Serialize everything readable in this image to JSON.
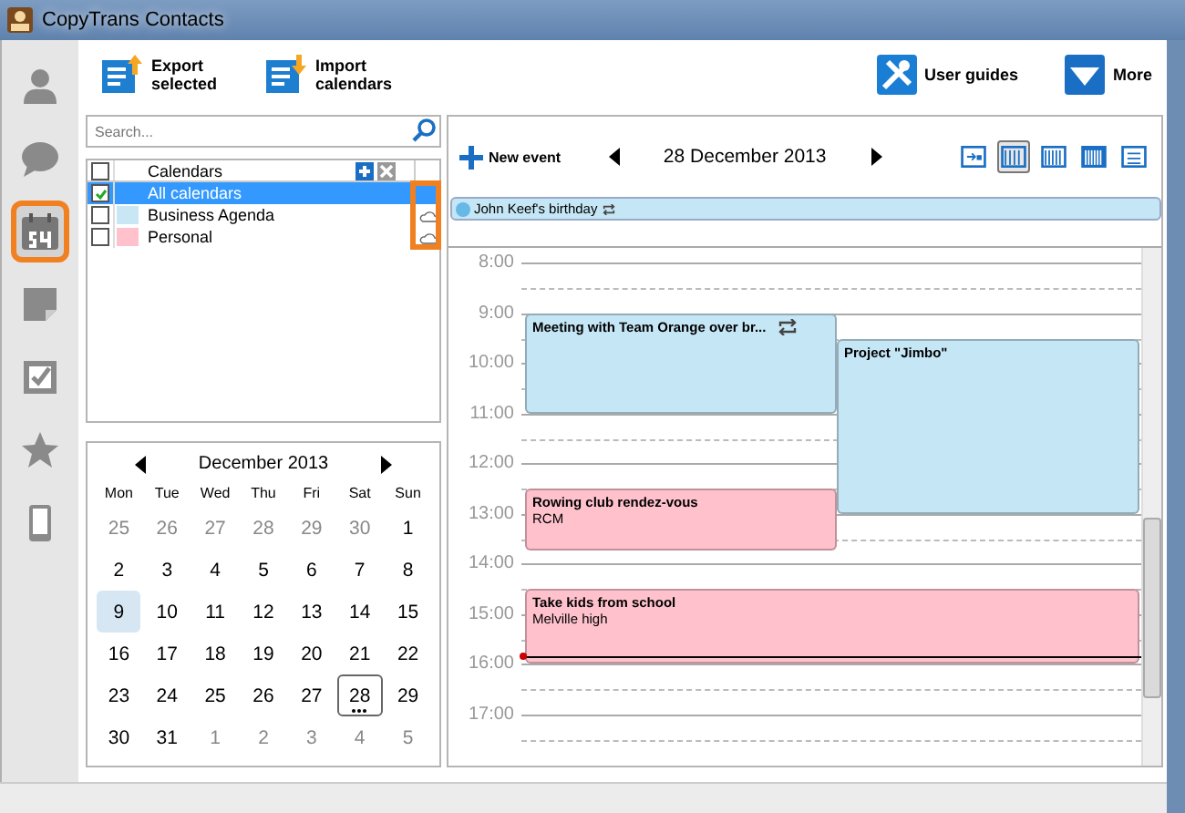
{
  "window": {
    "title": "CopyTrans Contacts"
  },
  "nav": [
    {
      "kind": "contacts",
      "selected": false,
      "highlighted": false
    },
    {
      "kind": "messages",
      "selected": false,
      "highlighted": false
    },
    {
      "kind": "calendar",
      "selected": true,
      "highlighted": true
    },
    {
      "kind": "notes",
      "selected": false,
      "highlighted": false
    },
    {
      "kind": "tasks",
      "selected": false,
      "highlighted": false
    },
    {
      "kind": "favorites",
      "selected": false,
      "highlighted": false
    },
    {
      "kind": "device",
      "selected": false,
      "highlighted": false
    }
  ],
  "toolbar": {
    "left": [
      {
        "kind": "export",
        "label": "Export\nselected"
      },
      {
        "kind": "import",
        "label": "Import\ncalendars"
      }
    ],
    "right": [
      {
        "kind": "guides",
        "label": "User guides"
      },
      {
        "kind": "more",
        "label": "More"
      }
    ]
  },
  "search": {
    "placeholder": "Search..."
  },
  "calendars": {
    "header": "Calendars",
    "header_checked": false,
    "sync_highlighted": true,
    "rows": [
      {
        "name": "All calendars",
        "checked": true,
        "selected": true,
        "sync": false
      },
      {
        "name": "Business Agenda",
        "checked": false,
        "selected": false,
        "color": "#c8e6f4",
        "sync": true
      },
      {
        "name": "Personal",
        "checked": false,
        "selected": false,
        "color": "#ffc2cd",
        "sync": true
      }
    ]
  },
  "mini_calendar": {
    "title": "December 2013",
    "weekdays": [
      "Mon",
      "Tue",
      "Wed",
      "Thu",
      "Fri",
      "Sat",
      "Sun"
    ],
    "weeks": [
      [
        {
          "day": "25",
          "outside": true,
          "today": false,
          "selected": false
        },
        {
          "day": "26",
          "outside": true,
          "today": false,
          "selected": false
        },
        {
          "day": "27",
          "outside": true,
          "today": false,
          "selected": false
        },
        {
          "day": "28",
          "outside": true,
          "today": false,
          "selected": false
        },
        {
          "day": "29",
          "outside": true,
          "today": false,
          "selected": false
        },
        {
          "day": "30",
          "outside": true,
          "today": false,
          "selected": false
        },
        {
          "day": "1",
          "outside": false,
          "today": false,
          "selected": false
        }
      ],
      [
        {
          "day": "2",
          "outside": false,
          "today": false,
          "selected": false
        },
        {
          "day": "3",
          "outside": false,
          "today": false,
          "selected": false
        },
        {
          "day": "4",
          "outside": false,
          "today": false,
          "selected": false
        },
        {
          "day": "5",
          "outside": false,
          "today": false,
          "selected": false
        },
        {
          "day": "6",
          "outside": false,
          "today": false,
          "selected": false
        },
        {
          "day": "7",
          "outside": false,
          "today": false,
          "selected": false
        },
        {
          "day": "8",
          "outside": false,
          "today": false,
          "selected": false
        }
      ],
      [
        {
          "day": "9",
          "outside": false,
          "today": true,
          "selected": false
        },
        {
          "day": "10",
          "outside": false,
          "today": false,
          "selected": false
        },
        {
          "day": "11",
          "outside": false,
          "today": false,
          "selected": false
        },
        {
          "day": "12",
          "outside": false,
          "today": false,
          "selected": false
        },
        {
          "day": "13",
          "outside": false,
          "today": false,
          "selected": false
        },
        {
          "day": "14",
          "outside": false,
          "today": false,
          "selected": false
        },
        {
          "day": "15",
          "outside": false,
          "today": false,
          "selected": false
        }
      ],
      [
        {
          "day": "16",
          "outside": false,
          "today": false,
          "selected": false
        },
        {
          "day": "17",
          "outside": false,
          "today": false,
          "selected": false
        },
        {
          "day": "18",
          "outside": false,
          "today": false,
          "selected": false
        },
        {
          "day": "19",
          "outside": false,
          "today": false,
          "selected": false
        },
        {
          "day": "20",
          "outside": false,
          "today": false,
          "selected": false
        },
        {
          "day": "21",
          "outside": false,
          "today": false,
          "selected": false
        },
        {
          "day": "22",
          "outside": false,
          "today": false,
          "selected": false
        }
      ],
      [
        {
          "day": "23",
          "outside": false,
          "today": false,
          "selected": false
        },
        {
          "day": "24",
          "outside": false,
          "today": false,
          "selected": false
        },
        {
          "day": "25",
          "outside": false,
          "today": false,
          "selected": false
        },
        {
          "day": "26",
          "outside": false,
          "today": false,
          "selected": false
        },
        {
          "day": "27",
          "outside": false,
          "today": false,
          "selected": false
        },
        {
          "day": "28",
          "outside": false,
          "today": false,
          "selected": true
        },
        {
          "day": "29",
          "outside": false,
          "today": false,
          "selected": false
        }
      ],
      [
        {
          "day": "30",
          "outside": false,
          "today": false,
          "selected": false
        },
        {
          "day": "31",
          "outside": false,
          "today": false,
          "selected": false
        },
        {
          "day": "1",
          "outside": true,
          "today": false,
          "selected": false
        },
        {
          "day": "2",
          "outside": true,
          "today": false,
          "selected": false
        },
        {
          "day": "3",
          "outside": true,
          "today": false,
          "selected": false
        },
        {
          "day": "4",
          "outside": true,
          "today": false,
          "selected": false
        },
        {
          "day": "5",
          "outside": true,
          "today": false,
          "selected": false
        }
      ]
    ]
  },
  "day_view": {
    "new_event": "New event",
    "date": "28 December 2013",
    "views": [
      {
        "kind": "day-task",
        "selected": false
      },
      {
        "kind": "day",
        "selected": true
      },
      {
        "kind": "week",
        "selected": false
      },
      {
        "kind": "month",
        "selected": false
      },
      {
        "kind": "list",
        "selected": false
      }
    ],
    "all_day": [
      {
        "title": "John Keef's birthday",
        "recurring": true
      }
    ],
    "hours": [
      "8:00",
      "9:00",
      "10:00",
      "11:00",
      "12:00",
      "13:00",
      "14:00",
      "15:00",
      "16:00",
      "17:00"
    ],
    "events": [
      {
        "title": "Meeting with Team Orange over br...",
        "color": "#c5e6f5",
        "recurring": true
      },
      {
        "title": "Project \"Jimbo\"",
        "color": "#c5e6f5",
        "recurring": false
      },
      {
        "title": "Rowing club rendez-vous",
        "location": "RCM",
        "color": "#ffc2cd",
        "recurring": false
      },
      {
        "title": "Take kids from school",
        "location": "Melville high",
        "color": "#ffc2cd",
        "recurring": false
      }
    ]
  }
}
